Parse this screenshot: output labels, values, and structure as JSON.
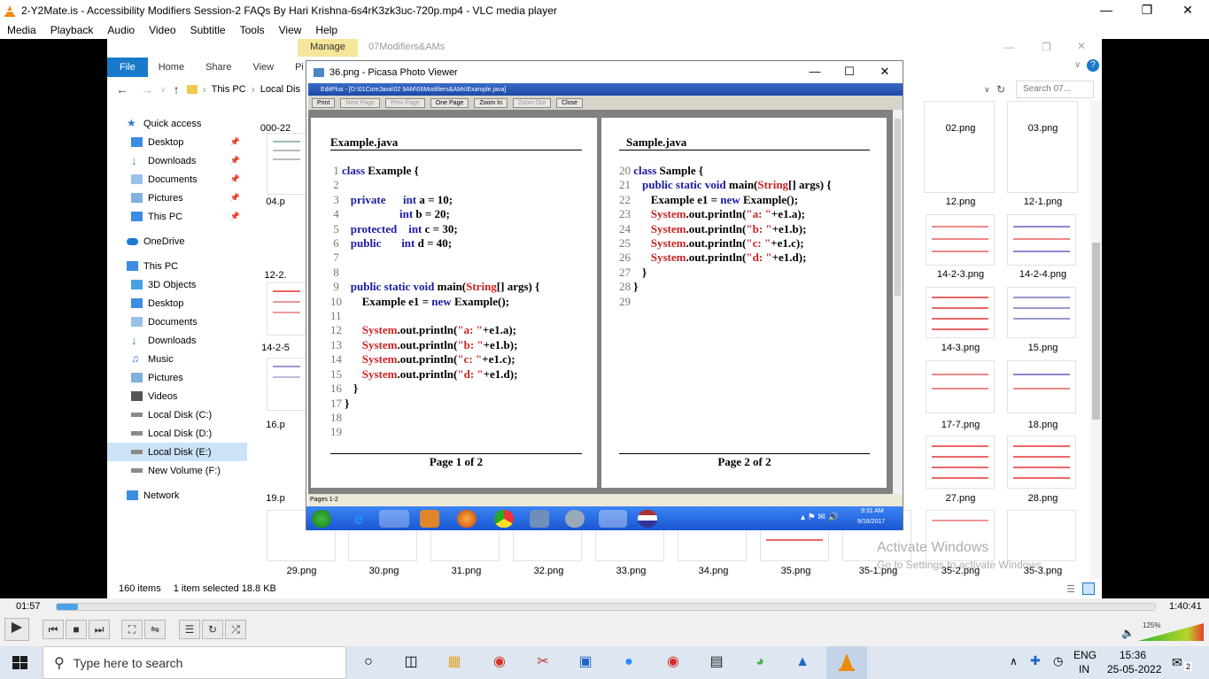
{
  "vlc": {
    "title": "2-Y2Mate.is - Accessibility Modifiers Session-2  FAQs  By Hari Krishna-6s4rK3zk3uc-720p.mp4 - VLC media player",
    "menu": [
      "Media",
      "Playback",
      "Audio",
      "Video",
      "Subtitle",
      "Tools",
      "View",
      "Help"
    ],
    "time_elapsed": "01:57",
    "time_total": "1:40:41",
    "seek_progress": 0.019,
    "volume_label": "125%",
    "volume_level": 1.0
  },
  "explorer": {
    "manage_tab": "Manage",
    "context_title": "07Modifiers&AMs",
    "tabs": [
      "File",
      "Home",
      "Share",
      "View",
      "Pi"
    ],
    "path": [
      "This PC",
      "Local Dis"
    ],
    "search_placeholder": "Search 07...",
    "nav": {
      "quick_access": "Quick access",
      "qa_items": [
        "Desktop",
        "Downloads",
        "Documents",
        "Pictures",
        "This PC"
      ],
      "onedrive": "OneDrive",
      "this_pc": "This PC",
      "pc_items": [
        "3D Objects",
        "Desktop",
        "Documents",
        "Downloads",
        "Music",
        "Pictures",
        "Videos",
        "Local Disk (C:)",
        "Local Disk (D:)",
        "Local Disk (E:)",
        "New Volume (F:)"
      ],
      "network": "Network"
    },
    "left_labels": [
      "000-22",
      "04.p",
      "12-2.",
      "14-2-5",
      "16.p",
      "19.p"
    ],
    "right_labels": {
      "r1": [
        "02.png",
        "03.png"
      ],
      "r2": [
        "12.png",
        "12-1.png"
      ],
      "r3": [
        "14-2-3.png",
        "14-2-4.png"
      ],
      "r4": [
        "14-3.png",
        "15.png"
      ],
      "r5": [
        "17-7.png",
        "18.png"
      ],
      "r6": [
        "27.png",
        "28.png"
      ]
    },
    "bottom_labels": [
      "29.png",
      "30.png",
      "31.png",
      "32.png",
      "33.png",
      "34.png",
      "35.png",
      "35-1.png",
      "35-2.png",
      "35-3.png"
    ],
    "status_count": "160 items",
    "status_selected": "1 item selected  18.8 KB",
    "watermark_1": "Activate Windows",
    "watermark_2": "Go to Settings to activate Windows."
  },
  "picasa": {
    "title": "36.png - Picasa Photo Viewer",
    "editplus_title": "EditPlus - [D:\\01CoreJava\\02 9AM\\06Modifiers&AMs\\Example.java]",
    "toolbar": [
      "Print",
      "Next Page",
      "Prev Page",
      "One Page",
      "Zoom In",
      "Zoom Out",
      "Close"
    ],
    "status": "Pages 1-2",
    "xp_clock_time": "9:31 AM",
    "xp_clock_date": "9/16/2017",
    "page1": {
      "title": "Example.java",
      "footer": "Page 1 of 2",
      "lines": [
        {
          "n": "1",
          "segs": [
            [
              "kw",
              "class "
            ],
            [
              "",
              "Example {"
            ]
          ]
        },
        {
          "n": "2",
          "segs": []
        },
        {
          "n": "3",
          "segs": [
            [
              "kw",
              "   private      "
            ],
            [
              "kw",
              "int "
            ],
            [
              "",
              "a = 10;"
            ]
          ]
        },
        {
          "n": "4",
          "segs": [
            [
              "",
              "                    "
            ],
            [
              "kw",
              "int "
            ],
            [
              "",
              "b = 20;"
            ]
          ]
        },
        {
          "n": "5",
          "segs": [
            [
              "kw",
              "   protected    "
            ],
            [
              "kw",
              "int "
            ],
            [
              "",
              "c = 30;"
            ]
          ]
        },
        {
          "n": "6",
          "segs": [
            [
              "kw",
              "   public       "
            ],
            [
              "kw",
              "int "
            ],
            [
              "",
              "d = 40;"
            ]
          ]
        },
        {
          "n": "7",
          "segs": []
        },
        {
          "n": "8",
          "segs": []
        },
        {
          "n": "9",
          "segs": [
            [
              "kw",
              "   public static void "
            ],
            [
              "",
              "main("
            ],
            [
              "str",
              "String"
            ],
            [
              "",
              "[] args) {"
            ]
          ]
        },
        {
          "n": "10",
          "segs": [
            [
              "",
              "      Example e1 = "
            ],
            [
              "kw",
              "new "
            ],
            [
              "",
              "Example();"
            ]
          ]
        },
        {
          "n": "11",
          "segs": []
        },
        {
          "n": "12",
          "segs": [
            [
              "sys",
              "      System"
            ],
            [
              "",
              ".out.println("
            ],
            [
              "str",
              "\"a: \""
            ],
            [
              "",
              "+e1.a);"
            ]
          ]
        },
        {
          "n": "13",
          "segs": [
            [
              "sys",
              "      System"
            ],
            [
              "",
              ".out.println("
            ],
            [
              "str",
              "\"b: \""
            ],
            [
              "",
              "+e1.b);"
            ]
          ]
        },
        {
          "n": "14",
          "segs": [
            [
              "sys",
              "      System"
            ],
            [
              "",
              ".out.println("
            ],
            [
              "str",
              "\"c: \""
            ],
            [
              "",
              "+e1.c);"
            ]
          ]
        },
        {
          "n": "15",
          "segs": [
            [
              "sys",
              "      System"
            ],
            [
              "",
              ".out.println("
            ],
            [
              "str",
              "\"d: \""
            ],
            [
              "",
              "+e1.d);"
            ]
          ]
        },
        {
          "n": "16",
          "segs": [
            [
              "",
              "   }"
            ]
          ]
        },
        {
          "n": "17",
          "segs": [
            [
              "",
              "}"
            ]
          ]
        },
        {
          "n": "18",
          "segs": []
        },
        {
          "n": "19",
          "segs": []
        }
      ]
    },
    "page2": {
      "title": "Sample.java",
      "footer": "Page 2 of 2",
      "lines": [
        {
          "n": "20",
          "segs": [
            [
              "kw",
              "class "
            ],
            [
              "",
              "Sample {"
            ]
          ]
        },
        {
          "n": "21",
          "segs": [
            [
              "kw",
              "   public static void "
            ],
            [
              "",
              "main("
            ],
            [
              "str",
              "String"
            ],
            [
              "",
              "[] args) {"
            ]
          ]
        },
        {
          "n": "22",
          "segs": [
            [
              "",
              "      Example e1 = "
            ],
            [
              "kw",
              "new "
            ],
            [
              "",
              "Example();"
            ]
          ]
        },
        {
          "n": "23",
          "segs": [
            [
              "sys",
              "      System"
            ],
            [
              "",
              ".out.println("
            ],
            [
              "str",
              "\"a: \""
            ],
            [
              "",
              "+e1.a);"
            ]
          ]
        },
        {
          "n": "24",
          "segs": [
            [
              "sys",
              "      System"
            ],
            [
              "",
              ".out.println("
            ],
            [
              "str",
              "\"b: \""
            ],
            [
              "",
              "+e1.b);"
            ]
          ]
        },
        {
          "n": "25",
          "segs": [
            [
              "sys",
              "      System"
            ],
            [
              "",
              ".out.println("
            ],
            [
              "str",
              "\"c: \""
            ],
            [
              "",
              "+e1.c);"
            ]
          ]
        },
        {
          "n": "26",
          "segs": [
            [
              "sys",
              "      System"
            ],
            [
              "",
              ".out.println("
            ],
            [
              "str",
              "\"d: \""
            ],
            [
              "",
              "+e1.d);"
            ]
          ]
        },
        {
          "n": "27",
          "segs": [
            [
              "",
              "   }"
            ]
          ]
        },
        {
          "n": "28",
          "segs": [
            [
              "",
              "}"
            ]
          ]
        },
        {
          "n": "29",
          "segs": []
        }
      ]
    }
  },
  "taskbar": {
    "search_placeholder": "Type here to search",
    "lang_1": "ENG",
    "lang_2": "IN",
    "time": "15:36",
    "date": "25-05-2022",
    "notification_count": "2"
  }
}
